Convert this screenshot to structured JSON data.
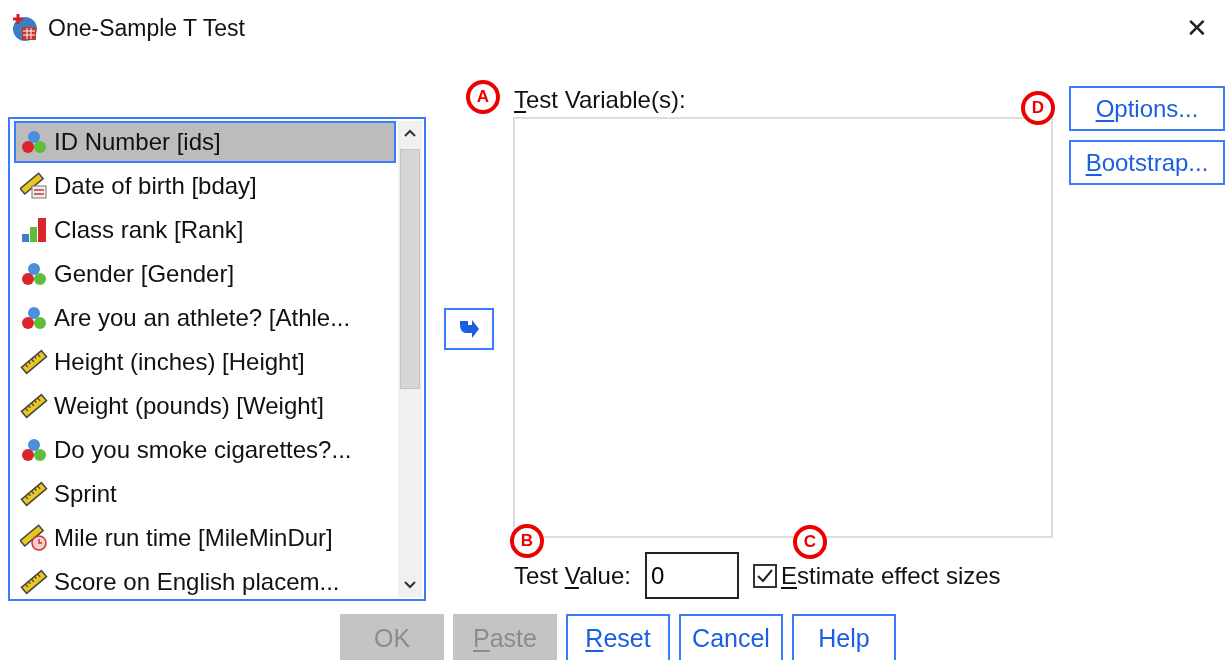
{
  "window": {
    "title": "One-Sample T Test",
    "close": "✕"
  },
  "variables": [
    {
      "label": "ID Number [ids]",
      "kind": "nominal",
      "selected": true
    },
    {
      "label": "Date of birth [bday]",
      "kind": "date",
      "selected": false
    },
    {
      "label": "Class rank [Rank]",
      "kind": "ordinal",
      "selected": false
    },
    {
      "label": "Gender [Gender]",
      "kind": "nominal",
      "selected": false
    },
    {
      "label": "Are you an athlete? [Athle...",
      "kind": "nominal",
      "selected": false
    },
    {
      "label": "Height (inches) [Height]",
      "kind": "scale",
      "selected": false
    },
    {
      "label": "Weight (pounds) [Weight]",
      "kind": "scale",
      "selected": false
    },
    {
      "label": "Do you smoke cigarettes?...",
      "kind": "nominal",
      "selected": false
    },
    {
      "label": "Sprint",
      "kind": "scale",
      "selected": false
    },
    {
      "label": "Mile run time [MileMinDur]",
      "kind": "time",
      "selected": false
    },
    {
      "label": "Score on English placem...",
      "kind": "scale",
      "selected": false
    }
  ],
  "test_variables": {
    "key": "T",
    "post": "est Variable(s):"
  },
  "side_buttons": [
    {
      "key": "O",
      "post": "ptions..."
    },
    {
      "key": "B",
      "post": "ootstrap..."
    }
  ],
  "test_value": {
    "pre": "Test ",
    "key": "V",
    "post": "alue:",
    "value": "0"
  },
  "effect_sizes": {
    "key": "E",
    "post": "stimate effect sizes",
    "checked": true
  },
  "buttons": [
    {
      "pre": "OK",
      "disabled": true
    },
    {
      "key": "P",
      "post": "aste",
      "disabled": true
    },
    {
      "key": "R",
      "post": "eset",
      "disabled": false
    },
    {
      "pre": "Cancel",
      "disabled": false
    },
    {
      "pre": "Help",
      "disabled": false
    }
  ],
  "markers": [
    {
      "letter": "A",
      "kind": "test_variables"
    },
    {
      "letter": "B",
      "kind": "test_value"
    },
    {
      "letter": "C",
      "kind": "effect_sizes"
    },
    {
      "letter": "D",
      "kind": "options"
    }
  ]
}
